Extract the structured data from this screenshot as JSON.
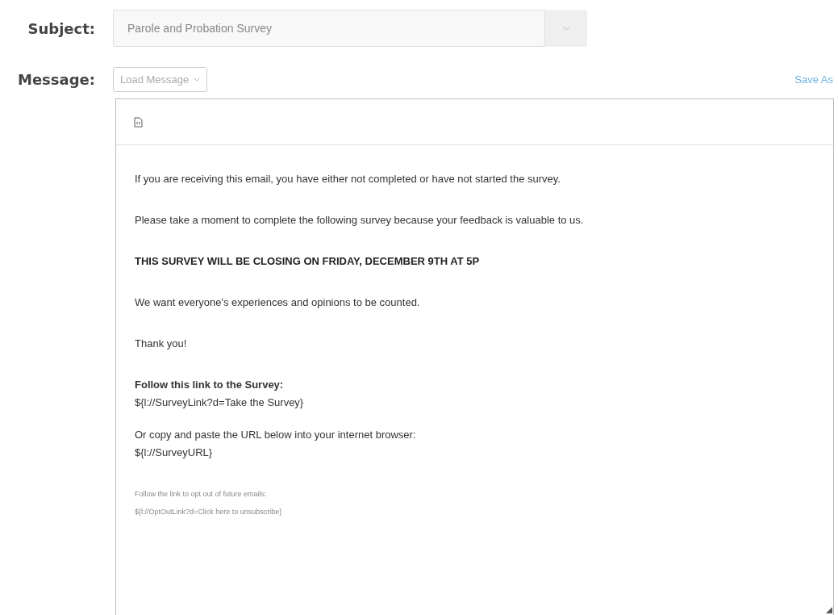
{
  "subject": {
    "label": "Subject:",
    "value": "Parole and Probation Survey"
  },
  "message": {
    "label": "Message:",
    "load_button": "Load Message",
    "save_as": "Save As"
  },
  "body": [
    {
      "kind": "normal",
      "lines": [
        "If you are receiving this email, you have either not completed or have not started the survey."
      ]
    },
    {
      "kind": "normal",
      "lines": [
        "Please take a moment to complete the following survey because your feedback is valuable to us."
      ]
    },
    {
      "kind": "heading",
      "lines": [
        "THIS SURVEY WILL BE CLOSING ON FRIDAY, DECEMBER 9TH AT 5P"
      ]
    },
    {
      "kind": "normal",
      "lines": [
        "We want everyone's experiences and opinions to be counted."
      ]
    },
    {
      "kind": "normal",
      "lines": [
        "Thank you!"
      ]
    },
    {
      "kind": "lead",
      "lines": [
        "Follow this link to the Survey:",
        "${l://SurveyLink?d=Take the Survey}"
      ]
    },
    {
      "kind": "normal",
      "lines": [
        "Or copy and paste the URL below into your internet browser:",
        "${l://SurveyURL}"
      ]
    },
    {
      "kind": "small",
      "lines": [
        "Follow the link to opt out of future emails:",
        "${l://OptOutLink?d=Click here to unsubscribe}"
      ]
    }
  ]
}
